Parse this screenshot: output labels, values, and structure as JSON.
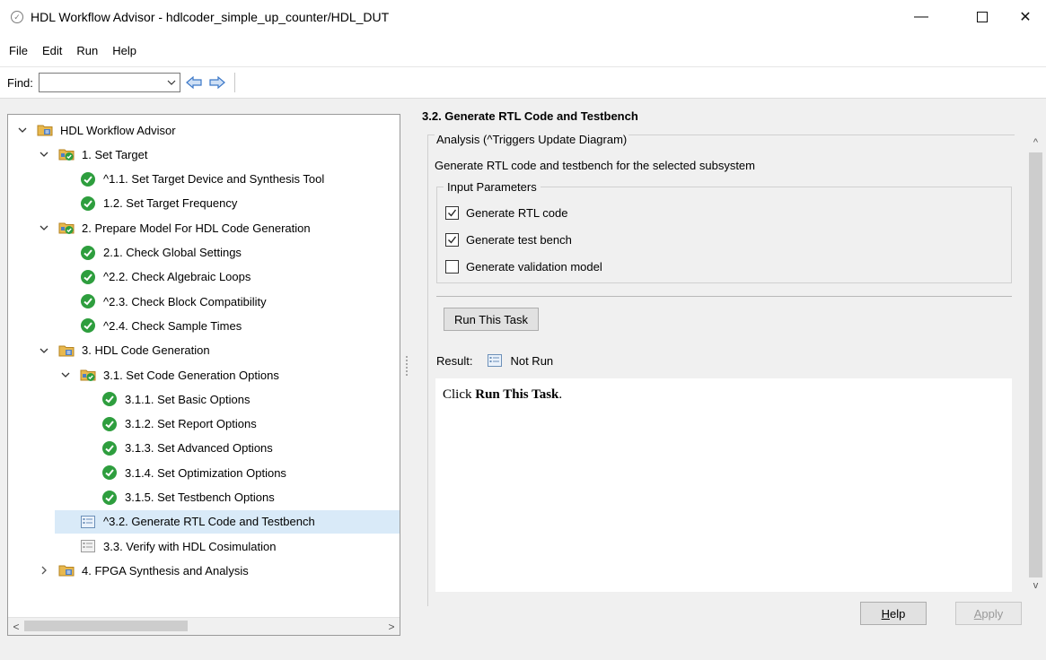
{
  "window": {
    "title": "HDL Workflow Advisor - hdlcoder_simple_up_counter/HDL_DUT",
    "minimize_glyph": "—",
    "close_glyph": "✕"
  },
  "menu": [
    "File",
    "Edit",
    "Run",
    "Help"
  ],
  "toolbar": {
    "find_label": "Find:",
    "find_value": "",
    "back_icon": "back-arrow-icon",
    "forward_icon": "forward-arrow-icon"
  },
  "tree": [
    {
      "label": "HDL Workflow Advisor",
      "icon": "folder-root-icon",
      "chevron": "down"
    },
    {
      "label": "1. Set Target",
      "icon": "folder-check-icon",
      "chevron": "down"
    },
    {
      "label": "^1.1. Set Target Device and Synthesis Tool",
      "icon": "check-circle-icon"
    },
    {
      "label": "1.2. Set Target Frequency",
      "icon": "check-circle-icon"
    },
    {
      "label": "2. Prepare Model For HDL Code Generation",
      "icon": "folder-check-icon",
      "chevron": "down"
    },
    {
      "label": "2.1. Check Global Settings",
      "icon": "check-circle-icon"
    },
    {
      "label": "^2.2. Check Algebraic Loops",
      "icon": "check-circle-icon"
    },
    {
      "label": "^2.3. Check Block Compatibility",
      "icon": "check-circle-icon"
    },
    {
      "label": "^2.4. Check Sample Times",
      "icon": "check-circle-icon"
    },
    {
      "label": "3. HDL Code Generation",
      "icon": "folder-root-icon",
      "chevron": "down"
    },
    {
      "label": "3.1. Set Code Generation Options",
      "icon": "folder-check-icon",
      "chevron": "down"
    },
    {
      "label": "3.1.1. Set Basic Options",
      "icon": "check-circle-icon"
    },
    {
      "label": "3.1.2. Set Report Options",
      "icon": "check-circle-icon"
    },
    {
      "label": "3.1.3. Set Advanced Options",
      "icon": "check-circle-icon"
    },
    {
      "label": "3.1.4. Set Optimization Options",
      "icon": "check-circle-icon"
    },
    {
      "label": "3.1.5. Set Testbench Options",
      "icon": "check-circle-icon"
    },
    {
      "label": "^3.2. Generate RTL Code and Testbench",
      "icon": "task-list-icon",
      "selected": true
    },
    {
      "label": "3.3. Verify with HDL Cosimulation",
      "icon": "task-list-gray-icon"
    },
    {
      "label": "4. FPGA Synthesis and Analysis",
      "icon": "folder-root-icon",
      "chevron": "right"
    }
  ],
  "detail": {
    "title": "3.2. Generate RTL Code and Testbench",
    "analysis_legend": "Analysis (^Triggers Update Diagram)",
    "description": "Generate RTL code and testbench for the selected subsystem",
    "input_params_legend": "Input Parameters",
    "checkboxes": [
      {
        "label": "Generate RTL code",
        "checked": true
      },
      {
        "label": "Generate test bench",
        "checked": true
      },
      {
        "label": "Generate validation model",
        "checked": false
      }
    ],
    "run_button": "Run This Task",
    "result_label": "Result:",
    "result_status": "Not Run",
    "result_text_prefix": "Click ",
    "result_text_bold": "Run This Task",
    "result_text_suffix": "."
  },
  "buttons": {
    "help_mnemonic": "H",
    "help_rest": "elp",
    "apply_mnemonic": "A",
    "apply_rest": "pply"
  },
  "colors": {
    "selected_row": "#d9eaf8",
    "check_green": "#2e9e3e",
    "folder_gold": "#d9a441",
    "nav_arrow_blue": "#3c78c8"
  }
}
